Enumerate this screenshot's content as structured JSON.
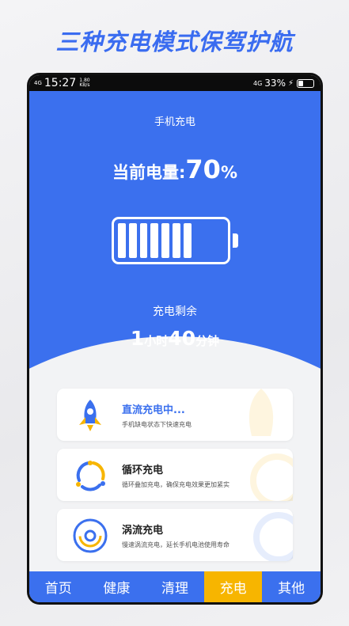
{
  "promo": {
    "title": "三种充电模式保驾护航"
  },
  "statusbar": {
    "signal": "4G",
    "time": "15:27",
    "speed_value": "1.80",
    "speed_unit": "KB/s",
    "network": "4G",
    "battery_percent": "33%"
  },
  "hero": {
    "title": "手机充电",
    "power_label": "当前电量:",
    "power_value": "70",
    "power_unit": "%",
    "battery_level": 0.7,
    "remaining_label": "充电剩余",
    "remaining_hours": "1",
    "hours_unit": "小时",
    "remaining_minutes": "40",
    "minutes_unit": "分钟"
  },
  "modes": [
    {
      "title": "直流充电中...",
      "desc": "手机缺电状态下快速充电",
      "icon": "rocket-icon",
      "active": true
    },
    {
      "title": "循环充电",
      "desc": "循环叠加充电，确保充电效果更加紧实",
      "icon": "cycle-icon",
      "active": false
    },
    {
      "title": "涡流充电",
      "desc": "慢速涡流充电，延长手机电池使用寿命",
      "icon": "vortex-icon",
      "active": false
    }
  ],
  "tabs": [
    {
      "label": "首页",
      "active": false
    },
    {
      "label": "健康",
      "active": false
    },
    {
      "label": "清理",
      "active": false
    },
    {
      "label": "充电",
      "active": true
    },
    {
      "label": "其他",
      "active": false
    }
  ],
  "colors": {
    "primary": "#3b70ee",
    "accent": "#f7b500"
  }
}
